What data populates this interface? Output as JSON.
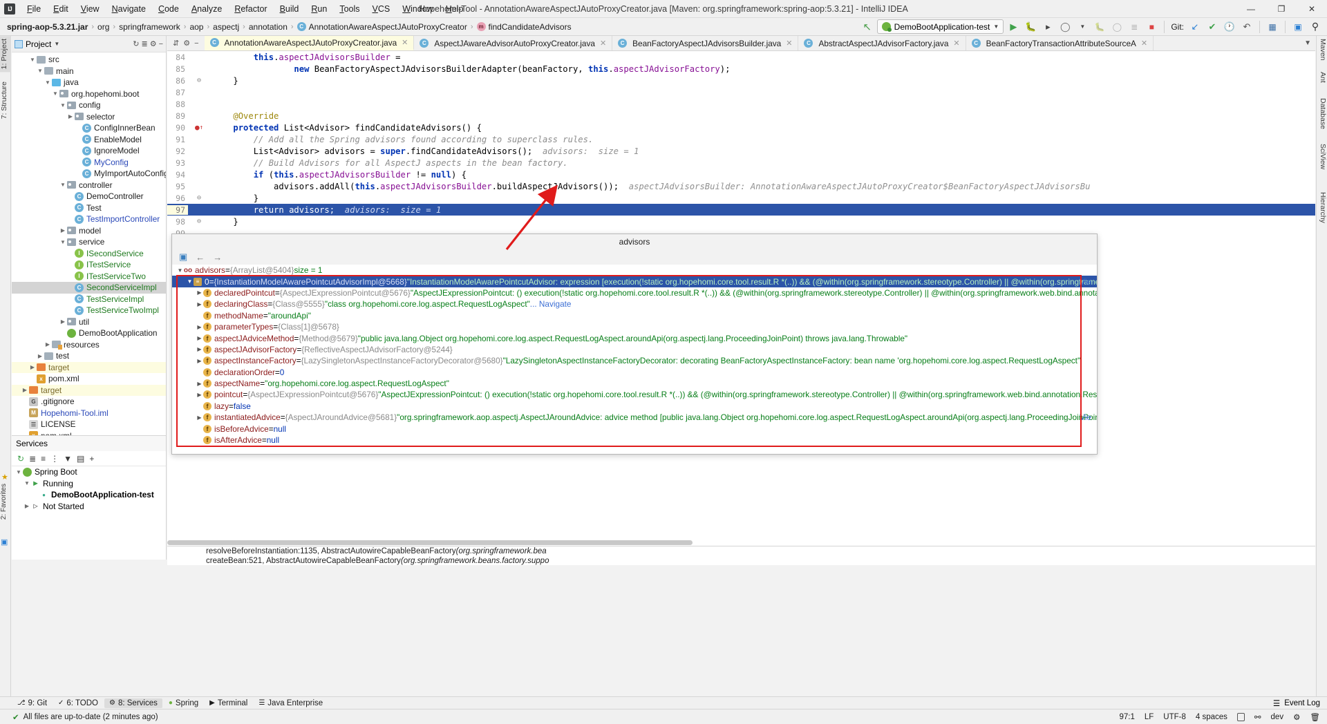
{
  "window": {
    "title": "Hopehomi-Tool - AnnotationAwareAspectJAutoProxyCreator.java [Maven: org.springframework:spring-aop:5.3.21] - IntelliJ IDEA",
    "minimize": "—",
    "maximize": "❐",
    "close": "✕"
  },
  "menu": [
    {
      "label": "File"
    },
    {
      "label": "Edit"
    },
    {
      "label": "View"
    },
    {
      "label": "Navigate"
    },
    {
      "label": "Code"
    },
    {
      "label": "Analyze"
    },
    {
      "label": "Refactor"
    },
    {
      "label": "Build"
    },
    {
      "label": "Run"
    },
    {
      "label": "Tools"
    },
    {
      "label": "VCS"
    },
    {
      "label": "Window"
    },
    {
      "label": "Help"
    }
  ],
  "breadcrumbs": [
    {
      "label": "spring-aop-5.3.21.jar",
      "bold": true,
      "icon": ""
    },
    {
      "label": "org",
      "bold": false,
      "icon": ""
    },
    {
      "label": "springframework",
      "bold": false,
      "icon": ""
    },
    {
      "label": "aop",
      "bold": false,
      "icon": ""
    },
    {
      "label": "aspectj",
      "bold": false,
      "icon": ""
    },
    {
      "label": "annotation",
      "bold": false,
      "icon": ""
    },
    {
      "label": "AnnotationAwareAspectJAutoProxyCreator",
      "bold": false,
      "icon": "class-icon",
      "iconChar": "C"
    },
    {
      "label": "findCandidateAdvisors",
      "bold": false,
      "icon": "method-icon",
      "iconChar": "m"
    }
  ],
  "toolbar": {
    "run_config": "DemoBootApplication-test",
    "git_label": "Git:",
    "icons": {
      "build": "⚒",
      "run": "▶",
      "debug": "🐞",
      "run_coverage": "▶",
      "profile": "◷",
      "stop": "■",
      "update": "↙",
      "commit": "✔",
      "history": "◴",
      "rollback": "↺",
      "structure": "▤",
      "terminal": "▣",
      "search": "⌕",
      "back_arrow": "↖"
    }
  },
  "left_tool_tabs": [
    {
      "label": "1: Project",
      "selected": true
    },
    {
      "label": "7: Structure",
      "selected": false
    }
  ],
  "right_tool_tabs": [
    {
      "label": "Maven"
    },
    {
      "label": "Ant"
    },
    {
      "label": "Database"
    },
    {
      "label": "SciView"
    },
    {
      "label": "Hierarchy"
    }
  ],
  "project_panel": {
    "title": "Project",
    "tree": [
      {
        "indent": 2,
        "twisty": "▼",
        "icon": "folder",
        "label": "src",
        "style": ""
      },
      {
        "indent": 3,
        "twisty": "▼",
        "icon": "folder",
        "label": "main",
        "style": ""
      },
      {
        "indent": 4,
        "twisty": "▼",
        "icon": "folder-blue",
        "label": "java",
        "style": ""
      },
      {
        "indent": 5,
        "twisty": "▼",
        "icon": "package",
        "label": "org.hopehomi.boot",
        "style": ""
      },
      {
        "indent": 6,
        "twisty": "▼",
        "icon": "package",
        "label": "config",
        "style": ""
      },
      {
        "indent": 7,
        "twisty": "▶",
        "icon": "package",
        "label": "selector",
        "style": ""
      },
      {
        "indent": 8,
        "twisty": "",
        "icon": "class",
        "label": "ConfigInnerBean",
        "style": ""
      },
      {
        "indent": 8,
        "twisty": "",
        "icon": "class",
        "label": "EnableModel",
        "style": ""
      },
      {
        "indent": 8,
        "twisty": "",
        "icon": "class",
        "label": "IgnoreModel",
        "style": ""
      },
      {
        "indent": 8,
        "twisty": "",
        "icon": "class",
        "label": "MyConfig",
        "style": "blue"
      },
      {
        "indent": 8,
        "twisty": "",
        "icon": "class",
        "label": "MyImportAutoConfiguration",
        "style": ""
      },
      {
        "indent": 6,
        "twisty": "▼",
        "icon": "package",
        "label": "controller",
        "style": ""
      },
      {
        "indent": 7,
        "twisty": "",
        "icon": "class",
        "label": "DemoController",
        "style": ""
      },
      {
        "indent": 7,
        "twisty": "",
        "icon": "class",
        "label": "Test",
        "style": ""
      },
      {
        "indent": 7,
        "twisty": "",
        "icon": "class",
        "label": "TestImportController",
        "style": "blue"
      },
      {
        "indent": 6,
        "twisty": "▶",
        "icon": "package",
        "label": "model",
        "style": ""
      },
      {
        "indent": 6,
        "twisty": "▼",
        "icon": "package",
        "label": "service",
        "style": ""
      },
      {
        "indent": 7,
        "twisty": "",
        "icon": "interface",
        "label": "ISecondService",
        "style": "green"
      },
      {
        "indent": 7,
        "twisty": "",
        "icon": "interface",
        "label": "ITestService",
        "style": "green"
      },
      {
        "indent": 7,
        "twisty": "",
        "icon": "interface",
        "label": "ITestServiceTwo",
        "style": "green"
      },
      {
        "indent": 7,
        "twisty": "",
        "icon": "class",
        "label": "SecondServiceImpl",
        "style": "green",
        "selected": true
      },
      {
        "indent": 7,
        "twisty": "",
        "icon": "class",
        "label": "TestServiceImpl",
        "style": "green"
      },
      {
        "indent": 7,
        "twisty": "",
        "icon": "class",
        "label": "TestServiceTwoImpl",
        "style": "green"
      },
      {
        "indent": 6,
        "twisty": "▶",
        "icon": "package",
        "label": "util",
        "style": ""
      },
      {
        "indent": 6,
        "twisty": "",
        "icon": "spring",
        "label": "DemoBootApplication",
        "style": ""
      },
      {
        "indent": 4,
        "twisty": "▶",
        "icon": "resources",
        "label": "resources",
        "style": ""
      },
      {
        "indent": 3,
        "twisty": "▶",
        "icon": "folder",
        "label": "test",
        "style": ""
      },
      {
        "indent": 2,
        "twisty": "▶",
        "icon": "folder-orange",
        "label": "target",
        "style": "brown",
        "target": true
      },
      {
        "indent": 2,
        "twisty": "",
        "icon": "xml",
        "label": "pom.xml",
        "style": ""
      },
      {
        "indent": 1,
        "twisty": "▶",
        "icon": "folder-orange",
        "label": "target",
        "style": "brown",
        "target": true
      },
      {
        "indent": 1,
        "twisty": "",
        "icon": "git",
        "label": ".gitignore",
        "style": ""
      },
      {
        "indent": 1,
        "twisty": "",
        "icon": "iml",
        "label": "Hopehomi-Tool.iml",
        "style": "blue"
      },
      {
        "indent": 1,
        "twisty": "",
        "icon": "txt",
        "label": "LICENSE",
        "style": ""
      },
      {
        "indent": 1,
        "twisty": "",
        "icon": "xml",
        "label": "pom.xml",
        "style": ""
      }
    ]
  },
  "services_panel": {
    "title": "Services",
    "rows": [
      {
        "indent": 0,
        "twisty": "▼",
        "icon": "spring",
        "label": "Spring Boot",
        "bold": false
      },
      {
        "indent": 1,
        "twisty": "▼",
        "icon": "run",
        "label": "Running",
        "bold": false
      },
      {
        "indent": 2,
        "twisty": "",
        "icon": "dot",
        "label": "DemoBootApplication-test",
        "bold": true
      },
      {
        "indent": 1,
        "twisty": "▶",
        "icon": "notstarted",
        "label": "Not Started",
        "bold": false
      }
    ]
  },
  "editor": {
    "tabs": [
      {
        "label": "AnnotationAwareAspectJAutoProxyCreator.java",
        "active": true,
        "close": "✕"
      },
      {
        "label": "AspectJAwareAdvisorAutoProxyCreator.java",
        "active": false,
        "close": "✕"
      },
      {
        "label": "BeanFactoryAspectJAdvisorsBuilder.java",
        "active": false,
        "close": "✕"
      },
      {
        "label": "AbstractAspectJAdvisorFactory.java",
        "active": false,
        "close": "✕"
      },
      {
        "label": "BeanFactoryTransactionAttributeSourceA",
        "active": false,
        "close": "✕"
      }
    ],
    "lines": [
      {
        "num": "84",
        "html": "        <span class='kw'>this</span>.<span class='fieldc'>aspectJAdvisorsBuilder</span> ="
      },
      {
        "num": "85",
        "html": "                <span class='kw'>new</span> BeanFactoryAspectJAdvisorsBuilderAdapter(beanFactory, <span class='kw'>this</span>.<span class='fieldc'>aspectJAdvisorFactory</span>);"
      },
      {
        "num": "86",
        "html": "    }",
        "fold": "⊖"
      },
      {
        "num": "87",
        "html": ""
      },
      {
        "num": "88",
        "html": ""
      },
      {
        "num": "89",
        "html": "    <span class='ann'>@Override</span>"
      },
      {
        "num": "90",
        "html": "    <span class='kw'>protected</span> List&lt;Advisor&gt; findCandidateAdvisors() {",
        "breakpoint": true,
        "fold": "⊖"
      },
      {
        "num": "91",
        "html": "        <span class='cmt'>// Add all the Spring advisors found according to superclass rules.</span>"
      },
      {
        "num": "92",
        "html": "        List&lt;Advisor&gt; advisors = <span class='kw'>super</span>.findCandidateAdvisors();  <span class='dbgval'>advisors:  size = 1</span>"
      },
      {
        "num": "93",
        "html": "        <span class='cmt'>// Build Advisors for all AspectJ aspects in the bean factory.</span>"
      },
      {
        "num": "94",
        "html": "        <span class='kw'>if</span> (<span class='kw'>this</span>.<span class='fieldc'>aspectJAdvisorsBuilder</span> != <span class='kw'>null</span>) {"
      },
      {
        "num": "95",
        "html": "            advisors.addAll(<span class='kw'>this</span>.<span class='fieldc'>aspectJAdvisorsBuilder</span>.buildAspectJAdvisors());  <span class='dbgval'>aspectJAdvisorsBuilder: AnnotationAwareAspectJAutoProxyCreator$BeanFactoryAspectJAdvisorsBu</span>"
      },
      {
        "num": "96",
        "html": "        }",
        "fold": "⊖"
      },
      {
        "num": "97",
        "html": "        <span class='kw' style='color:#fff;font-weight:normal'>return</span> advisors;  <span class='dbgval'>advisors:  size = 1</span>",
        "highlight": true
      },
      {
        "num": "98",
        "html": "    }",
        "fold": "⊖"
      },
      {
        "num": "99",
        "html": ""
      }
    ]
  },
  "debugger_popup": {
    "title": "advisors",
    "toolbar_icons": {
      "settings": "▣",
      "back": "←",
      "forward": "→"
    },
    "rows": [
      {
        "indent": 0,
        "twisty": "▼",
        "icon": "oo",
        "iconChar": "oo",
        "name": "advisors",
        "eq": " = ",
        "type": "{ArrayList@5404}",
        "value": "size = 1",
        "selected": false
      },
      {
        "indent": 1,
        "twisty": "▼",
        "icon": "list",
        "iconChar": "≡",
        "name": "0",
        "eq": " = ",
        "type": "{InstantiationModelAwarePointcutAdvisorImpl@5668}",
        "value": "\"InstantiationModelAwarePointcutAdvisor: expression [execution(!static org.hopehomi.core.tool.result.R *(..)) && (@within(org.springframework.stereotype.Controller) || @within(org.springframework.web.bi...",
        "selected": true,
        "more": "Vie"
      },
      {
        "indent": 2,
        "twisty": "▶",
        "icon": "f",
        "iconChar": "f",
        "name": "declaredPointcut",
        "eq": " = ",
        "type": "{AspectJExpressionPointcut@5676}",
        "value": "\"AspectJExpressionPointcut: () execution(!static org.hopehomi.core.tool.result.R *(..)) && (@within(org.springframework.stereotype.Controller) || @within(org.springframework.web.bind.annotation.RestController))\"",
        "selected": false
      },
      {
        "indent": 2,
        "twisty": "▶",
        "icon": "f",
        "iconChar": "f",
        "name": "declaringClass",
        "eq": " = ",
        "type": "{Class@5555}",
        "value": "\"class org.hopehomi.core.log.aspect.RequestLogAspect\"",
        "selected": false,
        "navigate": "... Navigate"
      },
      {
        "indent": 2,
        "twisty": "",
        "icon": "f",
        "iconChar": "f",
        "name": "methodName",
        "eq": " = ",
        "type": "",
        "value": "\"aroundApi\"",
        "selected": false
      },
      {
        "indent": 2,
        "twisty": "▶",
        "icon": "f",
        "iconChar": "f",
        "name": "parameterTypes",
        "eq": " = ",
        "type": "{Class[1]@5678}",
        "value": "",
        "selected": false
      },
      {
        "indent": 2,
        "twisty": "▶",
        "icon": "f",
        "iconChar": "f",
        "name": "aspectJAdviceMethod",
        "eq": " = ",
        "type": "{Method@5679}",
        "value": "\"public java.lang.Object org.hopehomi.core.log.aspect.RequestLogAspect.aroundApi(org.aspectj.lang.ProceedingJoinPoint) throws java.lang.Throwable\"",
        "selected": false
      },
      {
        "indent": 2,
        "twisty": "▶",
        "icon": "f",
        "iconChar": "f",
        "name": "aspectJAdvisorFactory",
        "eq": " = ",
        "type": "{ReflectiveAspectJAdvisorFactory@5244}",
        "value": "",
        "selected": false
      },
      {
        "indent": 2,
        "twisty": "▶",
        "icon": "f",
        "iconChar": "f",
        "name": "aspectInstanceFactory",
        "eq": " = ",
        "type": "{LazySingletonAspectInstanceFactoryDecorator@5680}",
        "value": "\"LazySingletonAspectInstanceFactoryDecorator: decorating BeanFactoryAspectInstanceFactory: bean name 'org.hopehomi.core.log.aspect.RequestLogAspect'\"",
        "selected": false
      },
      {
        "indent": 2,
        "twisty": "",
        "icon": "f",
        "iconChar": "f",
        "name": "declarationOrder",
        "eq": " = ",
        "type": "",
        "value": "0",
        "selected": false,
        "plain": true
      },
      {
        "indent": 2,
        "twisty": "▶",
        "icon": "f",
        "iconChar": "f",
        "name": "aspectName",
        "eq": " = ",
        "type": "",
        "value": "\"org.hopehomi.core.log.aspect.RequestLogAspect\"",
        "selected": false
      },
      {
        "indent": 2,
        "twisty": "▶",
        "icon": "f",
        "iconChar": "f",
        "name": "pointcut",
        "eq": " = ",
        "type": "{AspectJExpressionPointcut@5676}",
        "value": "\"AspectJExpressionPointcut: () execution(!static org.hopehomi.core.tool.result.R *(..)) && (@within(org.springframework.stereotype.Controller) || @within(org.springframework.web.bind.annotation.RestController))\"",
        "selected": false
      },
      {
        "indent": 2,
        "twisty": "",
        "icon": "f",
        "iconChar": "f",
        "name": "lazy",
        "eq": " = ",
        "type": "",
        "value": "false",
        "selected": false,
        "plain": true
      },
      {
        "indent": 2,
        "twisty": "▶",
        "icon": "f",
        "iconChar": "f",
        "name": "instantiatedAdvice",
        "eq": " = ",
        "type": "{AspectJAroundAdvice@5681}",
        "value": "\"org.springframework.aop.aspectj.AspectJAroundAdvice: advice method [public java.lang.Object org.hopehomi.core.log.aspect.RequestLogAspect.aroundApi(org.aspectj.lang.ProceedingJoinPoint) throws java.l...",
        "selected": false,
        "more": "Vie"
      },
      {
        "indent": 2,
        "twisty": "",
        "icon": "f",
        "iconChar": "f",
        "name": "isBeforeAdvice",
        "eq": " = ",
        "type": "",
        "value": "null",
        "selected": false,
        "plain": true
      },
      {
        "indent": 2,
        "twisty": "",
        "icon": "f",
        "iconChar": "f",
        "name": "isAfterAdvice",
        "eq": " = ",
        "type": "",
        "value": "null",
        "selected": false,
        "plain": true
      }
    ]
  },
  "console": {
    "lines": [
      {
        "text": "resolveBeforeInstantiation:1135, AbstractAutowireCapableBeanFactory ",
        "italic": "(org.springframework.bea"
      },
      {
        "text": "createBean:521, AbstractAutowireCapableBeanFactory ",
        "italic": "(org.springframework.beans.factory.suppo"
      }
    ]
  },
  "bottom_tool_buttons": [
    {
      "label": "9: Git",
      "icon": "branch-icon",
      "selected": false
    },
    {
      "label": "6: TODO",
      "icon": "check-icon",
      "selected": false
    },
    {
      "label": "8: Services",
      "icon": "services-icon",
      "selected": true
    },
    {
      "label": "Spring",
      "icon": "spring-icon",
      "selected": false
    },
    {
      "label": "Terminal",
      "icon": "terminal-icon",
      "selected": false
    },
    {
      "label": "Java Enterprise",
      "icon": "java-icon",
      "selected": false
    }
  ],
  "bottom_right": {
    "event_log": "Event Log",
    "event_icon": "☰"
  },
  "status_bar": {
    "message": "All files are up-to-date (2 minutes ago)",
    "caret": "97:1",
    "line_sep": "LF",
    "encoding": "UTF-8",
    "indent": "4 spaces",
    "branch": "dev",
    "lock": "lock-icon"
  },
  "colors": {
    "accent_blue": "#2c54a8",
    "highlight_red": "#e01b1b",
    "tab_active_bg": "#fdfce0",
    "green": "#1f7a1f",
    "string_green": "#067d17",
    "keyword_blue": "#0033b3",
    "field_purple": "#871094"
  }
}
